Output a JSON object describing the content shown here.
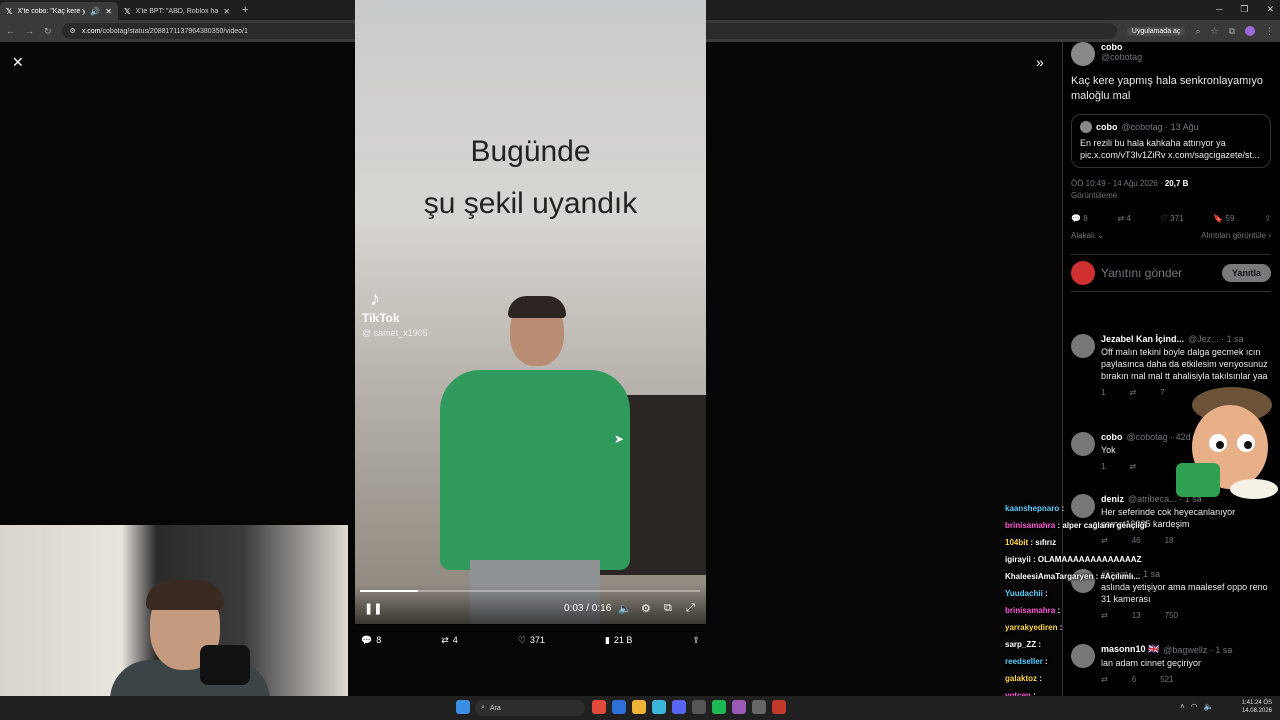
{
  "browser": {
    "tabs": [
      {
        "title": "X'te cobo: \"Kaç kere yapmı"
      },
      {
        "title": "X'te BPT: \"ABD, Roblox hakkınd"
      }
    ],
    "url_domain": "x.com",
    "url_path": "/cobotag/status/2088171137964380350/video/1",
    "open_app_label": "Uygulamada aç"
  },
  "video": {
    "caption_line1": "Bugünde",
    "caption_line2": "şu şekil uyandık",
    "tiktok_brand": "TikTok",
    "tiktok_user": "@ samet_x1905",
    "time": "0:03 / 0:16",
    "progress": 0.17,
    "stats": {
      "replies": "8",
      "reposts": "4",
      "likes": "371",
      "views": "21 B"
    }
  },
  "tweet": {
    "author_name": "cobo",
    "author_handle": "@cobotag",
    "text": "Kaç kere yapmış hala senkronlayamıyo maloğlu mal",
    "quote": {
      "name": "cobo",
      "handle": "@cobotag · 13 Ağu",
      "text": "En rezili bu hala kahkaha attırıyor ya pic.x.com/vT3lv1ZiRv x.com/sagcigazete/st..."
    },
    "timestamp": "ÖÖ 10:49 · 14 Ağu 2026 · ",
    "views_count": "20,7 B",
    "views_label": "Görüntüleme",
    "actions": {
      "replies": "8",
      "reposts": "4",
      "likes": "371",
      "bookmarks": "59"
    },
    "related_label": "Alakalı",
    "quotes_label": "Alıntıları görüntüle",
    "reply_placeholder": "Yanıtını gönder",
    "reply_button": "Yanıtla"
  },
  "replies": [
    {
      "name": "Jezabel Kan İçind...",
      "handle": "@Jez... · 1 sa",
      "text": "Off malın tekini boyle dalga gecmek ıcın paylasıncа daha da etkilesim verıyosunuz bırakın mal mal tt ahalisiyla takılsınlar yaa",
      "r": "1",
      "l": "7"
    },
    {
      "name": "cobo",
      "handle": "@cobotag · 42d",
      "text": "Yok",
      "r": "1",
      "l": ""
    },
    {
      "name": "deniz",
      "handle": "@atribeca... · 1 sa",
      "text": "Her seferinde cok heyecanlanıyor samet10905 kardeşim",
      "r": "",
      "l": "46",
      "v": "18"
    },
    {
      "name": "",
      "handle": "@aegt... · 1 sa",
      "text": "aslında yetişiyor ama maalesef oppo reno 31 kamerası",
      "r": "",
      "l": "13",
      "v": "750"
    },
    {
      "name": "masonn10 🇬🇧",
      "handle": "@bagwellz · 1 sa",
      "text": "lan adam cinnet geçiriyor",
      "r": "",
      "l": "6",
      "v": "521"
    }
  ],
  "chat": [
    {
      "user": "kaanshepnaro",
      "msg": ":",
      "cls": "u3"
    },
    {
      "user": "brinisamahra",
      "msg": ": alper cağların gençliği",
      "cls": "u1"
    },
    {
      "user": "104bit",
      "msg": ": sıfırız",
      "cls": "u2"
    },
    {
      "user": "igirayii",
      "msg": ": OLAMAAAAAAAAAAAAAZ",
      "cls": "u4"
    },
    {
      "user": "KhaleesiAmaTargaryen",
      "msg": ": #Açılımlı...",
      "cls": "u4"
    },
    {
      "user": "Yuudachii",
      "msg": ":",
      "cls": "u3"
    },
    {
      "user": "brinisamahra",
      "msg": ":",
      "cls": "u1"
    },
    {
      "user": "yarrakyediren",
      "msg": ":",
      "cls": "u2"
    },
    {
      "user": "sarp_ZZ",
      "msg": ":",
      "cls": "u4"
    },
    {
      "user": "reedseller",
      "msg": ":",
      "cls": "u3"
    },
    {
      "user": "galaktoz",
      "msg": ":",
      "cls": "u2"
    },
    {
      "user": "ygtcen",
      "msg": ":",
      "cls": "u1"
    }
  ],
  "taskbar": {
    "search_label": "Ara",
    "time": "1:41:24 ÖS",
    "date": "14.08.2026"
  }
}
